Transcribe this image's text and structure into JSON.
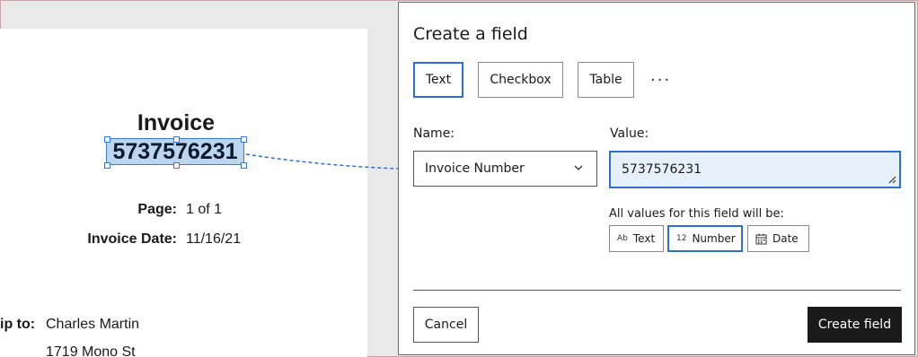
{
  "document": {
    "title": "Invoice",
    "invoice_number": "5737576231",
    "page_label": "Page:",
    "page_value": "1 of 1",
    "date_label": "Invoice Date:",
    "date_value": "11/16/21",
    "ship_label": "ip to:",
    "ship_name": "Charles Martin",
    "ship_address": "1719 Mono St"
  },
  "panel": {
    "title": "Create a field",
    "field_types": [
      "Text",
      "Checkbox",
      "Table"
    ],
    "selected_field_type": "Text",
    "more_label": "···",
    "name_label": "Name:",
    "name_value": "Invoice Number",
    "value_label": "Value:",
    "value_value": "5737576231",
    "hint": "All values for this field will be:",
    "value_types": [
      {
        "icon": "Ab",
        "label": "Text"
      },
      {
        "icon": "12",
        "label": "Number"
      },
      {
        "icon": "calendar-icon",
        "label": "Date"
      }
    ],
    "selected_value_type": "Number",
    "cancel_label": "Cancel",
    "create_label": "Create field"
  },
  "colors": {
    "accent": "#2f6fd0",
    "highlight": "#bcd6f0",
    "primary_button": "#1a1a1a"
  }
}
